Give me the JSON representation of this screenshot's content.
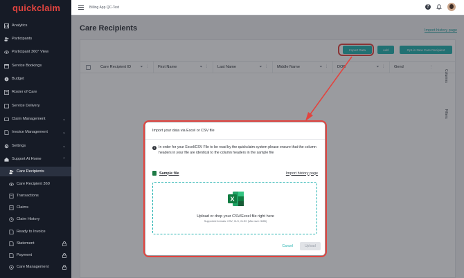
{
  "brand": {
    "name": "quickclaim",
    "accent": "#e2443f",
    "teal": "#23b2b0"
  },
  "topbar": {
    "app_title": "Billing App QC-Test"
  },
  "sidebar": {
    "items": [
      {
        "label": "Analytics",
        "icon": "chart-icon"
      },
      {
        "label": "Participants",
        "icon": "people-icon"
      },
      {
        "label": "Participant 360° View",
        "icon": "eye-icon"
      },
      {
        "label": "Service Bookings",
        "icon": "calendar-icon"
      },
      {
        "label": "Budget",
        "icon": "budget-icon"
      },
      {
        "label": "Roster of Care",
        "icon": "roster-icon"
      },
      {
        "label": "Service Delivery",
        "icon": "delivery-icon"
      },
      {
        "label": "Claim Management",
        "icon": "claim-icon",
        "chevron": "⌄"
      },
      {
        "label": "Invoice Management",
        "icon": "invoice-icon",
        "chevron": "⌄"
      },
      {
        "label": "Settings",
        "icon": "gear-icon",
        "chevron": "⌄"
      },
      {
        "label": "Support At Home",
        "icon": "home-icon",
        "chevron": "⌃"
      },
      {
        "label": "Care Recipients",
        "icon": "people-icon"
      },
      {
        "label": "Care Recipient 360",
        "icon": "eye-icon"
      },
      {
        "label": "Transactions",
        "icon": "transactions-icon"
      },
      {
        "label": "Claims",
        "icon": "claims-icon"
      },
      {
        "label": "Claim History",
        "icon": "history-icon"
      },
      {
        "label": "Ready to Invoice",
        "icon": "invoice-icon"
      },
      {
        "label": "Statement",
        "icon": "statement-icon"
      },
      {
        "label": "Payment",
        "icon": "payment-icon"
      },
      {
        "label": "Care Management",
        "icon": "care-icon"
      }
    ]
  },
  "page": {
    "title": "Care Recipients",
    "import_history_link": "Import history page"
  },
  "toolbar": {
    "import_label": "Import Data",
    "add_label": "Add",
    "optin_label": "Opt-in New Care Recipient"
  },
  "table": {
    "columns": [
      "Care Recipient ID",
      "First Name",
      "Last Name",
      "Middle Name",
      "DOB",
      "Gend"
    ],
    "side_tools": [
      "Columns",
      "Filters"
    ]
  },
  "modal": {
    "title": "Import your data via Excel or CSV file",
    "info": "In order for your Excel/CSV File to be read by the quickclaim system please ensure that the column headers in your file are identical to the column headers in the sample file",
    "sample_link": "Sample file",
    "history_link": "Import history page",
    "drop_main": "Upload or drop your CSV/Excel file right here",
    "drop_sub": "Supported formats: CSV, XLS, XLSX (Max size: 5MB)",
    "cancel": "Cancel",
    "upload": "Upload"
  }
}
